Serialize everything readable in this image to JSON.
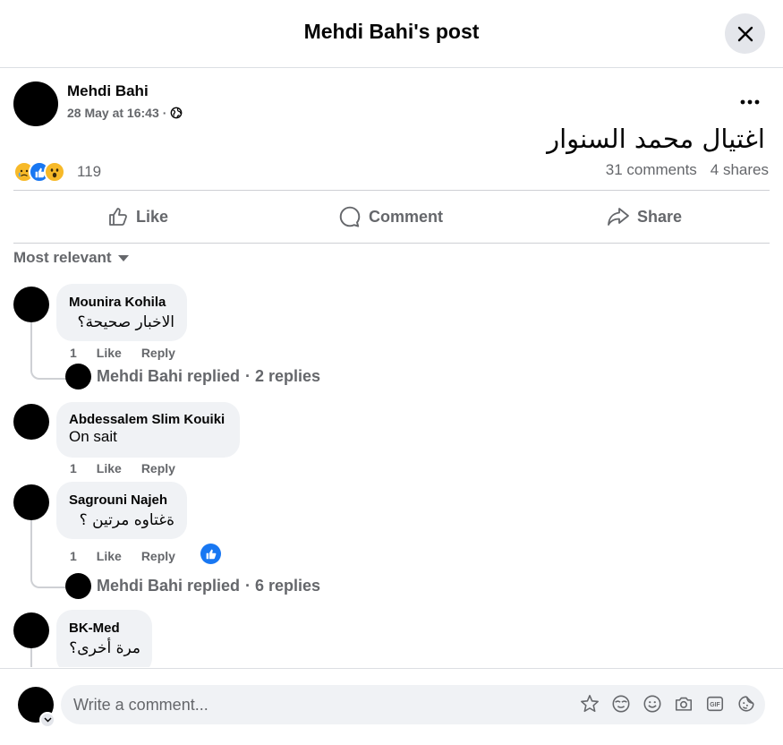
{
  "header": {
    "title": "Mehdi Bahi's post"
  },
  "post": {
    "author": "Mehdi Bahi",
    "timestamp": "28 May at 16:43",
    "separator": "·",
    "audience_icon": "globe-icon",
    "text": "اغتيال محمد السنوار",
    "reactions": {
      "icons": [
        "sad",
        "like",
        "wow"
      ],
      "count": "119"
    },
    "comments_count": "31 comments",
    "shares_count": "4 shares"
  },
  "actions": {
    "like": "Like",
    "comment": "Comment",
    "share": "Share"
  },
  "sort": {
    "label": "Most relevant"
  },
  "comments": [
    {
      "author": "Mounira Kohila",
      "text": "الاخبار صحيحة؟",
      "likes": "1",
      "like": "Like",
      "reply": "Reply",
      "replies": {
        "label": "Mehdi Bahi replied",
        "count": "· 2 replies"
      }
    },
    {
      "author": "Abdessalem Slim Kouiki",
      "text": "On sait",
      "likes": "1",
      "like": "Like",
      "reply": "Reply"
    },
    {
      "author": "Sagrouni Najeh",
      "text": "ةغتاوه مرتين ؟",
      "likes": "1",
      "like": "Like",
      "reply": "Reply",
      "replies": {
        "label": "Mehdi Bahi replied",
        "count": "· 6 replies"
      }
    },
    {
      "author": "BK-Med",
      "text": "مرة أخرى؟"
    }
  ],
  "composer": {
    "placeholder": "Write a comment..."
  },
  "colors": {
    "accent": "#1877f2",
    "secondary_text": "#65676b",
    "bubble": "#f0f2f5"
  }
}
